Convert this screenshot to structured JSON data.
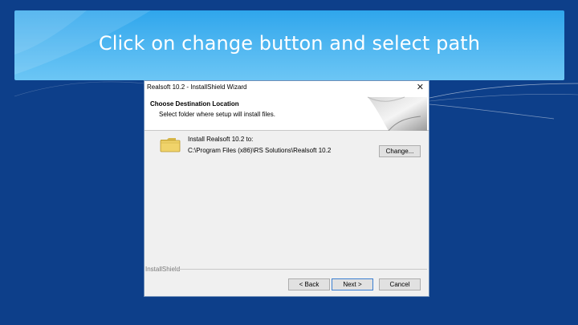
{
  "slide": {
    "title": "Click on change button and select path"
  },
  "dialog": {
    "window_title": "Realsoft 10.2 - InstallShield Wizard",
    "close_glyph": "✕",
    "heading": "Choose Destination Location",
    "subheading": "Select folder where setup will install files.",
    "install_label": "Install Realsoft 10.2 to:",
    "install_path": "C:\\Program Files (x86)\\RS Solutions\\Realsoft 10.2",
    "change_button": "Change...",
    "brand_footer": "InstallShield",
    "back_button": "< Back",
    "next_button": "Next >",
    "cancel_button": "Cancel"
  },
  "icons": {
    "close": "close-icon",
    "folder": "folder-icon",
    "banner_graphic": "page-curl-icon"
  },
  "colors": {
    "background": "#0d3f8a",
    "header_gradient_top": "#2fa6ec",
    "header_gradient_bottom": "#6cc6f5",
    "title_text": "#ffffff",
    "dialog_body": "#f0f0f0",
    "focus_border": "#3c7fd1"
  }
}
